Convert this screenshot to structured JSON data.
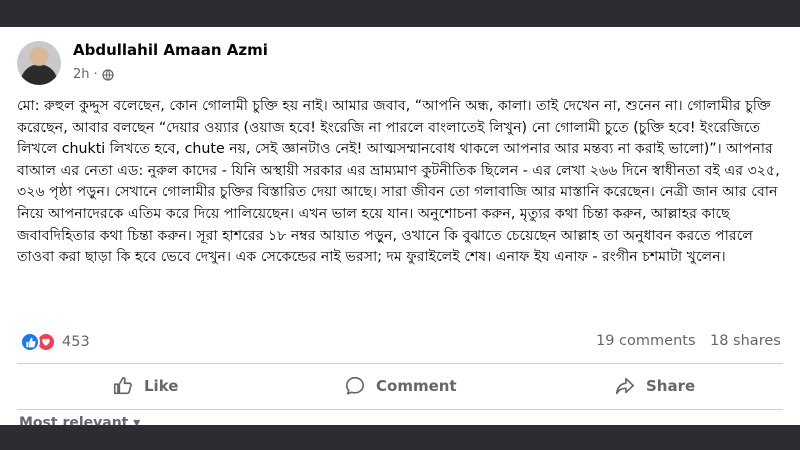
{
  "post": {
    "author": "Abdullahil Amaan Azmi",
    "time": "2h",
    "dot": "·",
    "text": "মো: রুহুল কুদ্দুস বলেছেন, কোন গোলামী চুক্তি হয় নাই। আমার জবাব, “আপনি অন্ধ, কালা। তাই দেখেন না, শুনেন না। গোলামীর চুক্তি করেছেন, আবার বলছেন “দেয়ার ওয়্যার (ওয়াজ হবে! ইংরেজি না পারলে বাংলাতেই লিখুন) নো গোলামী চুতে (চুক্তি হবে! ইংরেজিতে লিখলে chukti লিখতে হবে, chute নয়, সেই জ্ঞানটাও নেই! আত্মসম্মানবোধ থাকলে আপনার আর মন্তব্য না করাই ভালো)”। আপনার বাআল এর নেতা এড: নুরুল কাদের - যিনি অস্থায়ী সরকার এর ভ্রাম্যমাণ কুটনীতিক ছিলেন - এর লেখা ২৬৬ দিনে স্বাধীনতা বই এর ৩২৫, ৩২৬ পৃষ্ঠা পড়ুন। সেখানে গোলামীর চুক্তির বিস্তারিত দেয়া আছে। সারা জীবন তো গলাবাজি আর মাস্তানি করেছেন। নেত্রী জান আর বোন নিয়ে আপনাদেরকে এতিম করে দিয়ে পালিয়েছেন। এখন ভাল হয়ে যান। অনুশোচনা করুন, মৃত্যুর কথা চিন্তা করুন, আল্লাহর কাছে জবাবদিহিতার কথা চিন্তা করুন। সূরা হাশরের ১৮ নম্বর আয়াত পড়ুন, ওখানে কি বুঝাতে চেয়েছেন আল্লাহ তা অনুধাবন করতে পারলে তাওবা করা ছাড়া কি হবে ভেবে দেখুন। এক সেকেন্ডের নাই ভরসা; দম ফুরাইলেই শেষ। এনাফ ইয এনাফ - রংগীন চশমাটা খুলেন।",
    "reaction_count": "453",
    "comments": "19 comments",
    "shares": "18 shares"
  },
  "actions": {
    "like": "Like",
    "comment": "Comment",
    "share": "Share"
  },
  "comments_section": {
    "sort_label": "Most relevant"
  },
  "icons": {
    "privacy": "globe-icon",
    "like": "thumbs-up-icon",
    "comment": "speech-bubble-icon",
    "share": "share-arrow-icon"
  },
  "colors": {
    "like_blue": "#1877f2",
    "love_red": "#f33e58",
    "secondary_text": "#65676b",
    "divider": "#ced0d4"
  }
}
